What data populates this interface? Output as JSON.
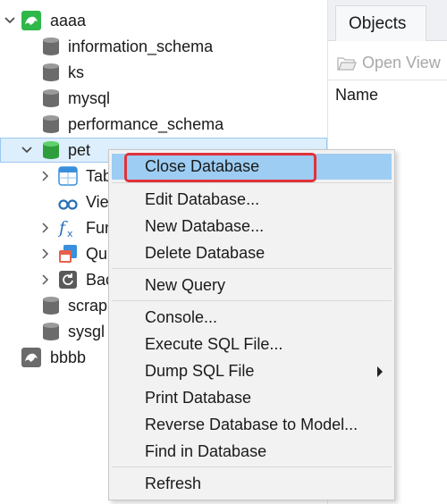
{
  "tree": {
    "connections": [
      {
        "name": "aaaa",
        "icon": "mysql-connection-icon"
      },
      {
        "name": "bbbb",
        "icon": "mysql-connection-icon"
      }
    ],
    "databases": [
      {
        "name": "information_schema"
      },
      {
        "name": "ks"
      },
      {
        "name": "mysql"
      },
      {
        "name": "performance_schema"
      },
      {
        "name": "pet"
      },
      {
        "name": "scrap"
      },
      {
        "name": "sysgl"
      }
    ],
    "pet_children": [
      {
        "label": "Tab",
        "icon": "table-icon"
      },
      {
        "label": "Vie",
        "icon": "view-icon"
      },
      {
        "label": "Fur",
        "icon": "function-icon"
      },
      {
        "label": "Qu",
        "icon": "query-icon"
      },
      {
        "label": "Bac",
        "icon": "backup-icon"
      }
    ]
  },
  "right_pane": {
    "tab_label": "Objects",
    "open_view_label": "Open View",
    "column_header": "Name"
  },
  "context_menu": {
    "items": [
      {
        "label": "Close Database",
        "highlighted": true
      },
      {
        "label": "Edit Database..."
      },
      {
        "label": "New Database..."
      },
      {
        "label": "Delete Database"
      },
      {
        "label": "New Query"
      },
      {
        "label": "Console..."
      },
      {
        "label": "Execute SQL File..."
      },
      {
        "label": "Dump SQL File",
        "submenu": true
      },
      {
        "label": "Print Database"
      },
      {
        "label": "Reverse Database to Model..."
      },
      {
        "label": "Find in Database"
      },
      {
        "label": "Refresh"
      }
    ]
  },
  "colors": {
    "highlight": "#9dcdf3",
    "annotation_box": "#e0323a",
    "selection": "#ddeefc",
    "db_active": "#3cb84a",
    "db_inactive": "#6b6b6b"
  }
}
